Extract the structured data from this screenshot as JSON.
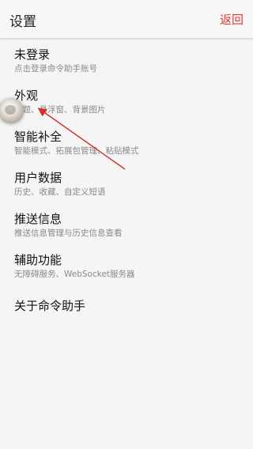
{
  "app_bar": {
    "title": "设置",
    "back_label": "返回",
    "back_color": "#e53935"
  },
  "menu": {
    "items": [
      {
        "title": "未登录",
        "subtitle": "点击登录命令助手账号"
      },
      {
        "title": "外观",
        "subtitle": "主题、悬浮窗、背景图片"
      },
      {
        "title": "智能补全",
        "subtitle": "智能模式、拓展包管理、粘贴模式"
      },
      {
        "title": "用户数据",
        "subtitle": "历史、收藏、自定义短语"
      },
      {
        "title": "推送信息",
        "subtitle": "推送信息管理与历史信息查看"
      },
      {
        "title": "辅助功能",
        "subtitle": "无障碍服务、WebSocket服务器"
      },
      {
        "title": "关于命令助手",
        "subtitle": ""
      }
    ]
  },
  "annotation": {
    "arrow_color": "#d32f2f"
  }
}
